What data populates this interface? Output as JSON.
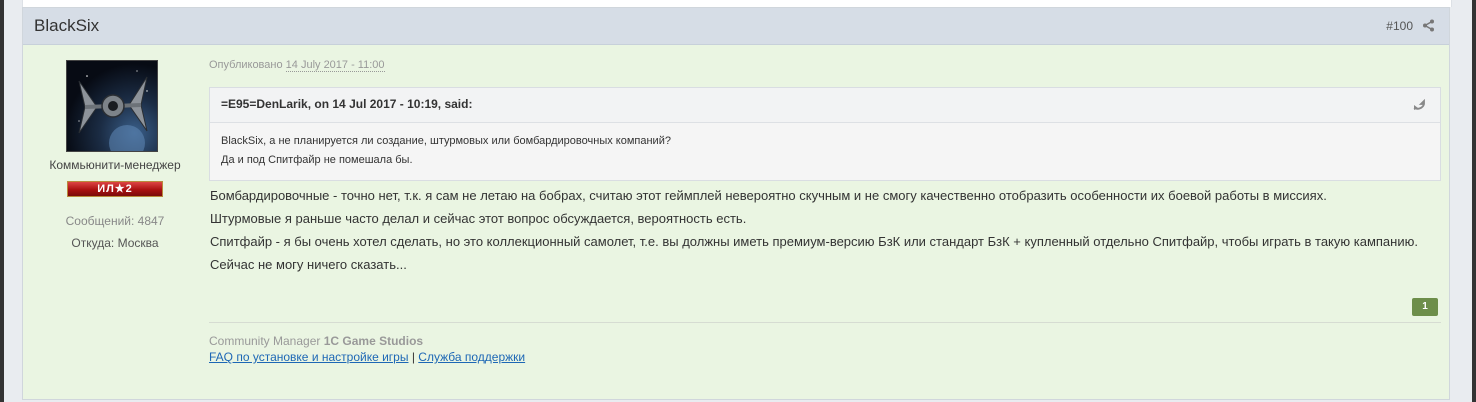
{
  "post": {
    "author": "BlackSix",
    "number": "#100",
    "user_title": "Коммьюнити-менеджер",
    "rank": "ИЛ★2",
    "posts_count": "Сообщений: 4847",
    "location": "Откуда: Москва",
    "published_label": "Опубликовано",
    "published_date": "14 July 2017 - 11:00",
    "quote": {
      "cite": "=E95=DenLarik, on 14 Jul 2017 - 10:19, said:",
      "lines": [
        "BlackSix, а не планируется ли создание, штурмовых или бомбардировочных компаний?",
        "Да и под Спитфайр не помешала бы."
      ]
    },
    "body": [
      "Бомбардировочные - точно нет, т.к. я сам не летаю на бобрах, считаю этот геймплей невероятно скучным и не смогу качественно отобразить особенности их боевой работы в миссиях.",
      "Штурмовые я раньше часто делал и сейчас этот вопрос обсуждается, вероятность есть.",
      "Спитфайр - я бы очень хотел сделать, но это коллекционный самолет, т.е. вы должны иметь премиум-версию БзК или стандарт БзК + купленный отдельно Спитфайр, чтобы играть в такую кампанию. Сейчас не могу ничего сказать..."
    ],
    "reputation": "1",
    "signature": {
      "prefix": "Community Manager",
      "company": "1C Game Studios",
      "link1": "FAQ по установке и настройке игры",
      "separator": "|",
      "link2": "Служба поддержки"
    }
  },
  "icons": {
    "share": "share-icon",
    "snapback": "snapback-icon"
  }
}
